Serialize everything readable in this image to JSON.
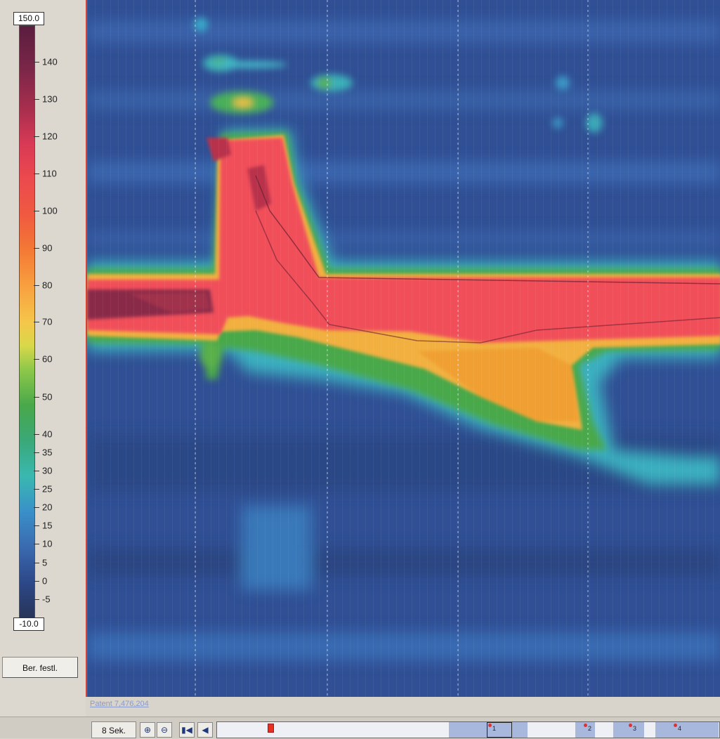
{
  "scale": {
    "max_label": "150.0",
    "min_label": "-10.0",
    "ticks": [
      "140",
      "130",
      "120",
      "110",
      "100",
      "90",
      "80",
      "70",
      "60",
      "50",
      "40",
      "35",
      "30",
      "25",
      "20",
      "15",
      "10",
      "5",
      "0",
      "-5"
    ]
  },
  "controls": {
    "fix_button": "Ber. festl.",
    "speed_button": "8 Sek."
  },
  "plot": {
    "watermark": "Patent 7,476,204"
  },
  "toolbar_icons": [
    "zoom-in-icon",
    "zoom-out-icon",
    "skip-start-icon",
    "step-back-icon"
  ],
  "timeline": {
    "markers": [
      "1",
      "2",
      "3",
      "4"
    ]
  },
  "colors": {
    "low": "#2e4a8e",
    "mid": "#4aa84a",
    "high": "#f05060",
    "peak": "#7a2648"
  }
}
